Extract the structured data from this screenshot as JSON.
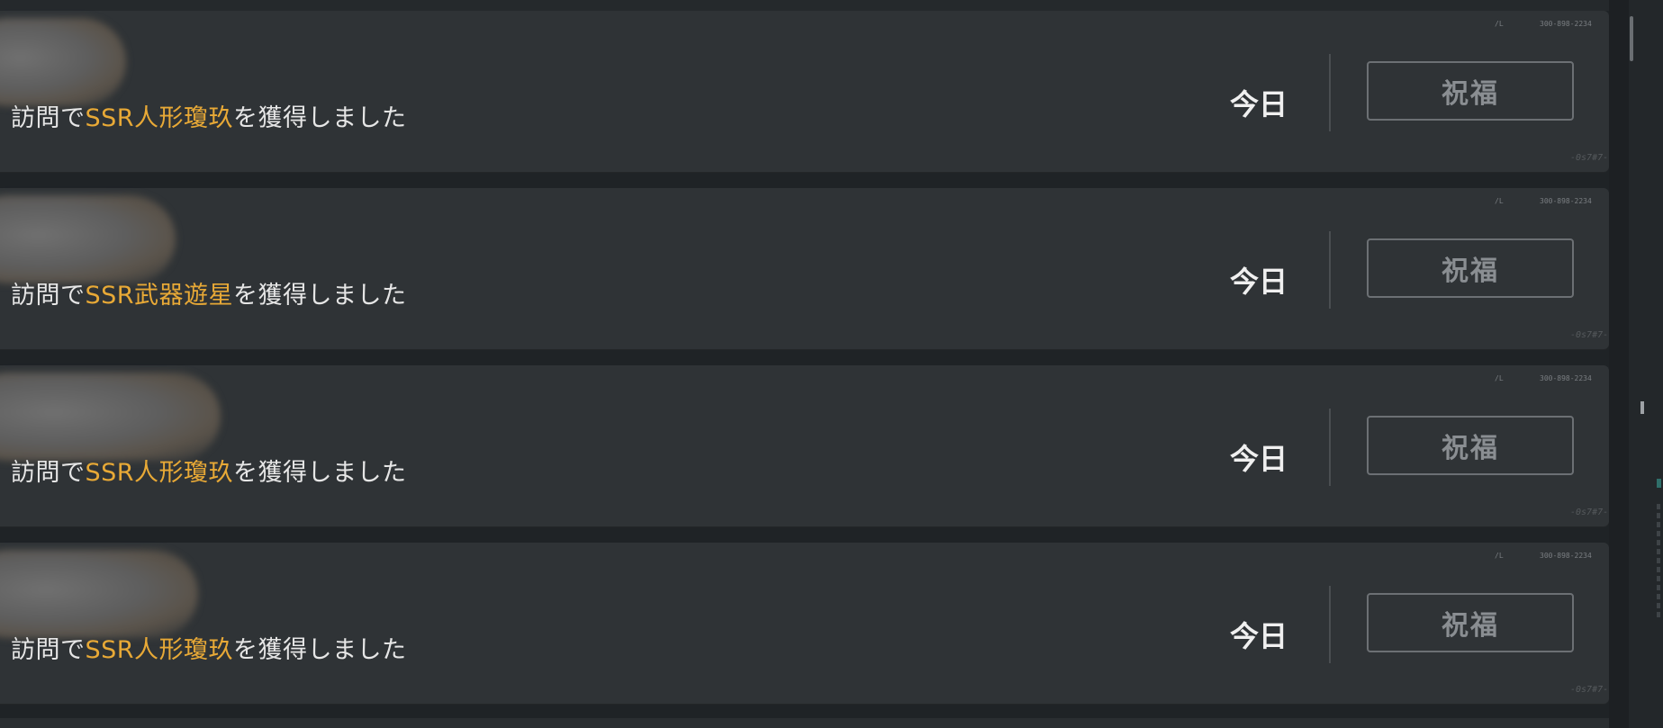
{
  "notifications": [
    {
      "message_prefix": "訪問で",
      "highlight": "SSR人形瓊玖",
      "message_suffix": "を獲得しました",
      "date": "今日",
      "action_label": "祝福",
      "corner_code": "300-898-2234",
      "corner_mark": "/L",
      "stamp": "-0s7#7-"
    },
    {
      "message_prefix": "訪問で",
      "highlight": "SSR武器遊星",
      "message_suffix": "を獲得しました",
      "date": "今日",
      "action_label": "祝福",
      "corner_code": "300-898-2234",
      "corner_mark": "/L",
      "stamp": "-0s7#7-"
    },
    {
      "message_prefix": "訪問で",
      "highlight": "SSR人形瓊玖",
      "message_suffix": "を獲得しました",
      "date": "今日",
      "action_label": "祝福",
      "corner_code": "300-898-2234",
      "corner_mark": "/L",
      "stamp": "-0s7#7-"
    },
    {
      "message_prefix": "訪問で",
      "highlight": "SSR人形瓊玖",
      "message_suffix": "を獲得しました",
      "date": "今日",
      "action_label": "祝福",
      "corner_code": "300-898-2234",
      "corner_mark": "/L",
      "stamp": "-0s7#7-"
    }
  ],
  "colors": {
    "highlight": "#e8a936",
    "card_background": "#2f3336",
    "page_background": "#1f2326"
  }
}
